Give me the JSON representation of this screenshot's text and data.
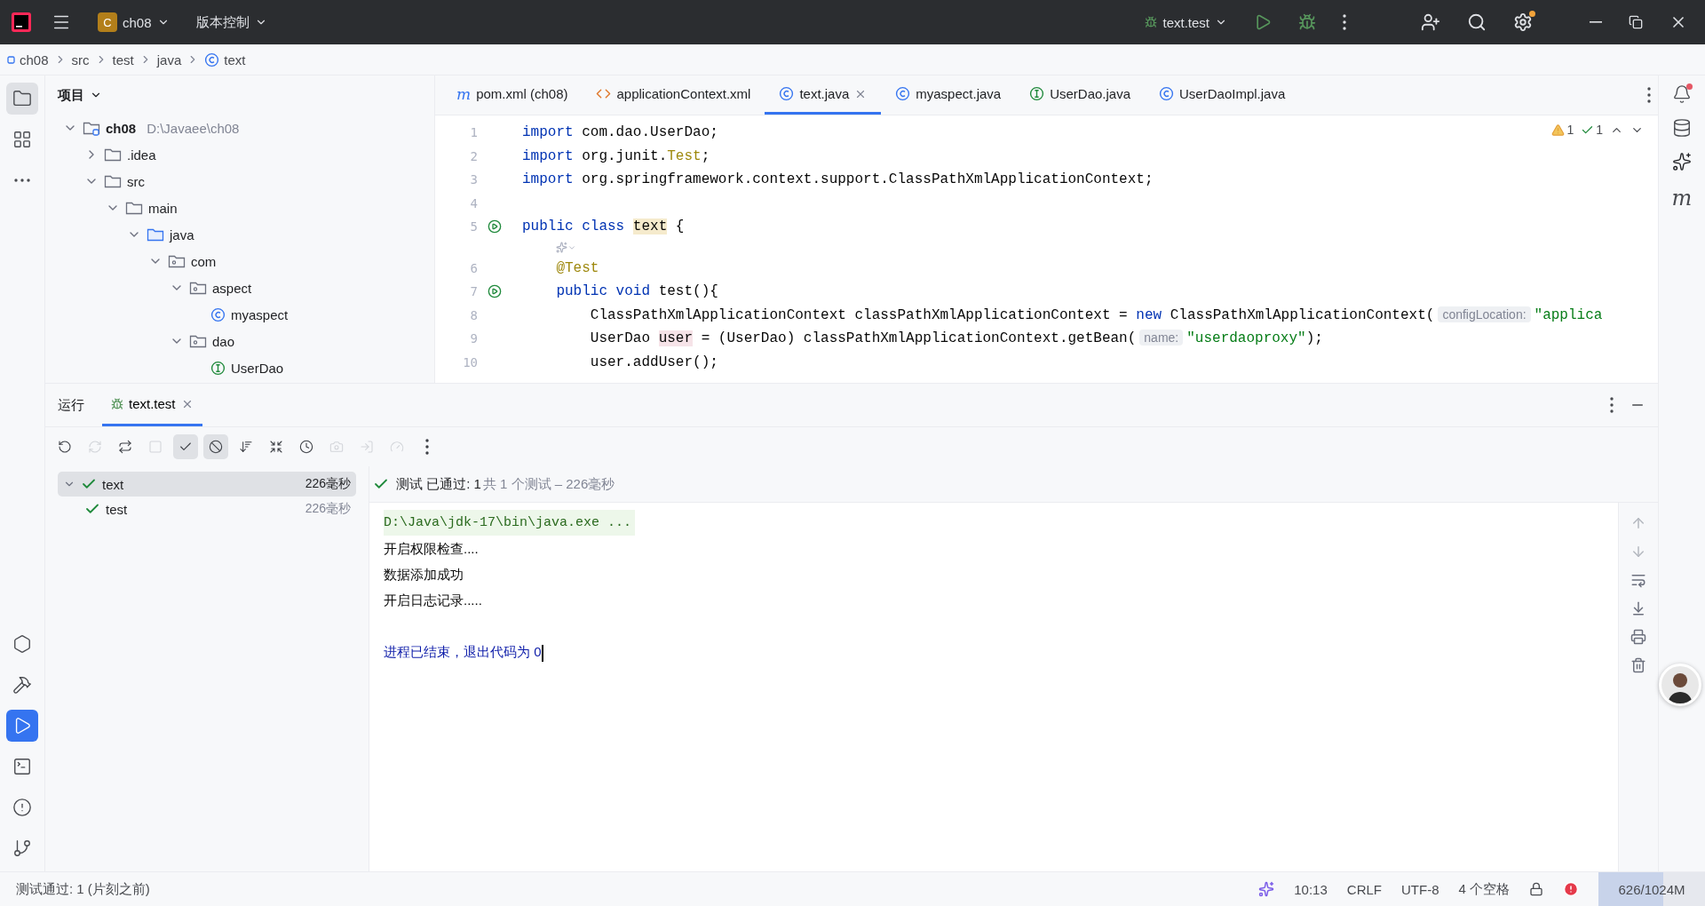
{
  "title_bar": {
    "project_badge": "C",
    "project": "ch08",
    "vcs": "版本控制",
    "run_config": "text.test"
  },
  "breadcrumb": [
    {
      "label": "ch08",
      "kind": "module"
    },
    {
      "label": "src",
      "kind": "plain"
    },
    {
      "label": "test",
      "kind": "plain"
    },
    {
      "label": "java",
      "kind": "plain"
    },
    {
      "label": "text",
      "kind": "class"
    }
  ],
  "left_toolbar": {
    "top": [
      {
        "kind": "project",
        "selected": true
      },
      {
        "kind": "structure",
        "selected": false
      },
      {
        "kind": "more",
        "selected": false
      }
    ],
    "bottom": [
      {
        "kind": "services",
        "selected": false
      },
      {
        "kind": "build",
        "selected": false
      },
      {
        "kind": "run",
        "selected": true
      },
      {
        "kind": "terminal",
        "selected": false
      },
      {
        "kind": "problems",
        "selected": false
      },
      {
        "kind": "git",
        "selected": false
      }
    ]
  },
  "project_panel": {
    "title": "项目",
    "tree": [
      {
        "label": "ch08",
        "hint": "D:\\Javaee\\ch08",
        "kind": "module",
        "expanded": true,
        "children": [
          {
            "label": ".idea",
            "kind": "folder",
            "expanded": false
          },
          {
            "label": "src",
            "kind": "folder",
            "expanded": true,
            "children": [
              {
                "label": "main",
                "kind": "folder",
                "expanded": true,
                "children": [
                  {
                    "label": "java",
                    "kind": "source",
                    "expanded": true,
                    "children": [
                      {
                        "label": "com",
                        "kind": "package",
                        "expanded": true,
                        "children": [
                          {
                            "label": "aspect",
                            "kind": "package",
                            "expanded": true,
                            "children": [
                              {
                                "label": "myaspect",
                                "kind": "class"
                              }
                            ]
                          },
                          {
                            "label": "dao",
                            "kind": "package",
                            "expanded": true,
                            "children": [
                              {
                                "label": "UserDao",
                                "kind": "interface"
                              }
                            ]
                          }
                        ]
                      }
                    ]
                  }
                ]
              }
            ]
          }
        ]
      }
    ]
  },
  "editor": {
    "tabs": [
      {
        "label": "pom.xml (ch08)",
        "kind": "maven",
        "glyph": "m",
        "selected": false
      },
      {
        "label": "applicationContext.xml",
        "kind": "xml",
        "selected": false
      },
      {
        "label": "text.java",
        "kind": "class",
        "selected": true
      },
      {
        "label": "myaspect.java",
        "kind": "class",
        "selected": false
      },
      {
        "label": "UserDao.java",
        "kind": "interface",
        "selected": false
      },
      {
        "label": "UserDaoImpl.java",
        "kind": "class",
        "selected": false
      }
    ],
    "inspections": {
      "warnings": "1",
      "passed": "1"
    },
    "lines": [
      {
        "number": "1",
        "tokens": [
          {
            "kind": "kw",
            "text": "import"
          },
          {
            "kind": "plain",
            "text": " com.dao.UserDao;"
          }
        ]
      },
      {
        "number": "2",
        "tokens": [
          {
            "kind": "kw",
            "text": "import"
          },
          {
            "kind": "plain",
            "text": " org.junit."
          },
          {
            "kind": "ann",
            "text": "Test"
          },
          {
            "kind": "plain",
            "text": ";"
          }
        ]
      },
      {
        "number": "3",
        "tokens": [
          {
            "kind": "kw",
            "text": "import"
          },
          {
            "kind": "plain",
            "text": " org.springframework.context.support.ClassPathXmlApplicationContext;"
          }
        ]
      },
      {
        "number": "4"
      },
      {
        "number": "5",
        "run_gutter": true,
        "tokens": [
          {
            "kind": "kw",
            "text": "public class "
          },
          {
            "kind": "mark",
            "text": "text"
          },
          {
            "kind": "plain",
            "text": " {"
          }
        ]
      },
      {
        "kind": "inlay"
      },
      {
        "number": "6",
        "tokens": [
          {
            "kind": "ann",
            "text": "    @Test"
          }
        ]
      },
      {
        "number": "7",
        "run_gutter": true,
        "tokens": [
          {
            "kind": "kw",
            "text": "    public void "
          },
          {
            "kind": "plain",
            "text": "test(){"
          }
        ]
      },
      {
        "number": "8",
        "tokens": [
          {
            "kind": "plain",
            "text": "        ClassPathXmlApplicationContext classPathXmlApplicationContext = "
          },
          {
            "kind": "kw",
            "text": "new"
          },
          {
            "kind": "plain",
            "text": " ClassPathXmlApplicationContext("
          },
          {
            "kind": "hint",
            "text": "configLocation:"
          },
          {
            "kind": "str",
            "text": "\"applica"
          }
        ]
      },
      {
        "number": "9",
        "tokens": [
          {
            "kind": "plain",
            "text": "        UserDao "
          },
          {
            "kind": "usage",
            "text": "user"
          },
          {
            "kind": "plain",
            "text": " = (UserDao) classPathXmlApplicationContext.getBean("
          },
          {
            "kind": "hint",
            "text": "name:"
          },
          {
            "kind": "str",
            "text": "\"userdaoproxy\""
          },
          {
            "kind": "plain",
            "text": ");"
          }
        ]
      },
      {
        "number": "10",
        "tokens": [
          {
            "kind": "plain",
            "text": "        user.addUser();"
          }
        ]
      }
    ]
  },
  "run_panel": {
    "title": "运行",
    "tabs": [
      {
        "label": "text.test",
        "selected": true
      }
    ],
    "toolbar": [
      {
        "kind": "rerun",
        "on": false,
        "disabled": false
      },
      {
        "kind": "rerun-failed",
        "on": false,
        "disabled": true
      },
      {
        "kind": "auto",
        "on": false,
        "disabled": false
      },
      {
        "kind": "stop",
        "on": false,
        "disabled": true
      },
      {
        "kind": "show-passed",
        "on": true,
        "disabled": false
      },
      {
        "kind": "show-ignored",
        "on": true,
        "disabled": false
      },
      {
        "kind": "sort",
        "on": false,
        "disabled": false
      },
      {
        "kind": "collapse",
        "on": false,
        "disabled": false
      },
      {
        "kind": "history",
        "on": false,
        "disabled": false
      },
      {
        "kind": "camera",
        "on": false,
        "disabled": true
      },
      {
        "kind": "import",
        "on": false,
        "disabled": true
      },
      {
        "kind": "gauge",
        "on": false,
        "disabled": true
      },
      {
        "kind": "more",
        "on": false,
        "disabled": false
      }
    ],
    "tests": [
      {
        "name": "text",
        "time": "226毫秒",
        "passed": true,
        "selected": true,
        "expanded": true,
        "children": [
          {
            "name": "test",
            "time": "226毫秒",
            "passed": true,
            "selected": false
          }
        ]
      }
    ],
    "summary": {
      "status": "测试 已通过: 1",
      "detail": "共 1 个测试 – 226毫秒"
    },
    "console": [
      {
        "kind": "command",
        "text": "D:\\Java\\jdk-17\\bin\\java.exe ..."
      },
      {
        "kind": "output",
        "text": "开启权限检查...."
      },
      {
        "kind": "output",
        "text": "数据添加成功"
      },
      {
        "kind": "output",
        "text": "开启日志记录....."
      },
      {
        "kind": "exit",
        "text": "进程已结束，退出代码为 0"
      }
    ]
  },
  "right_toolbar": [
    {
      "kind": "notifications"
    },
    {
      "kind": "database"
    },
    {
      "kind": "ai"
    },
    {
      "kind": "maven",
      "glyph": "m"
    }
  ],
  "status_bar": {
    "message": "测试通过: 1 (片刻之前)",
    "items": [
      "10:13",
      "CRLF",
      "UTF-8",
      "4 个空格"
    ],
    "memory": {
      "text": "626/1024M",
      "level": 0.61
    }
  }
}
